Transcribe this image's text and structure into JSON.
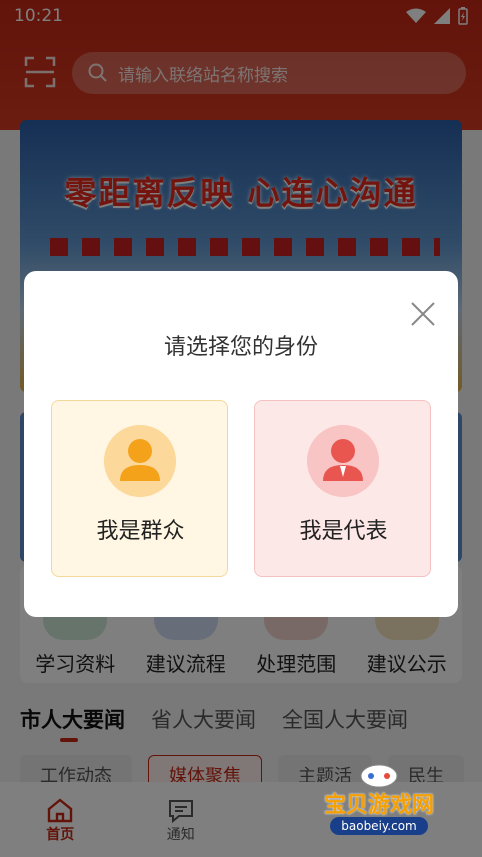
{
  "status_bar": {
    "time": "10:21"
  },
  "search": {
    "placeholder": "请输入联络站名称搜索"
  },
  "banner": {
    "slogan": "零距离反映  心连心沟通"
  },
  "grid": [
    {
      "label": "学习资料",
      "color": "#4caf78"
    },
    {
      "label": "建议流程",
      "color": "#3f7fd6"
    },
    {
      "label": "处理范围",
      "color": "#e0553c"
    },
    {
      "label": "建议公示",
      "color": "#e8a43a"
    }
  ],
  "news_tabs": [
    "市人大要闻",
    "省人大要闻",
    "全国人大要闻"
  ],
  "chips": [
    "工作动态",
    "媒体聚焦",
    "主题活",
    "民生"
  ],
  "bottom_nav": [
    {
      "label": "首页",
      "icon": "home-icon"
    },
    {
      "label": "通知",
      "icon": "message-icon"
    }
  ],
  "dialog": {
    "title": "请选择您的身份",
    "options": [
      {
        "label": "我是群众",
        "icon": "person-icon"
      },
      {
        "label": "我是代表",
        "icon": "representative-icon"
      }
    ]
  },
  "watermark": {
    "text": "宝贝游戏网",
    "url": "baobeiy.com"
  },
  "colors": {
    "brand_red": "#c62815",
    "overlay": "rgba(0,0,0,0.5)"
  }
}
